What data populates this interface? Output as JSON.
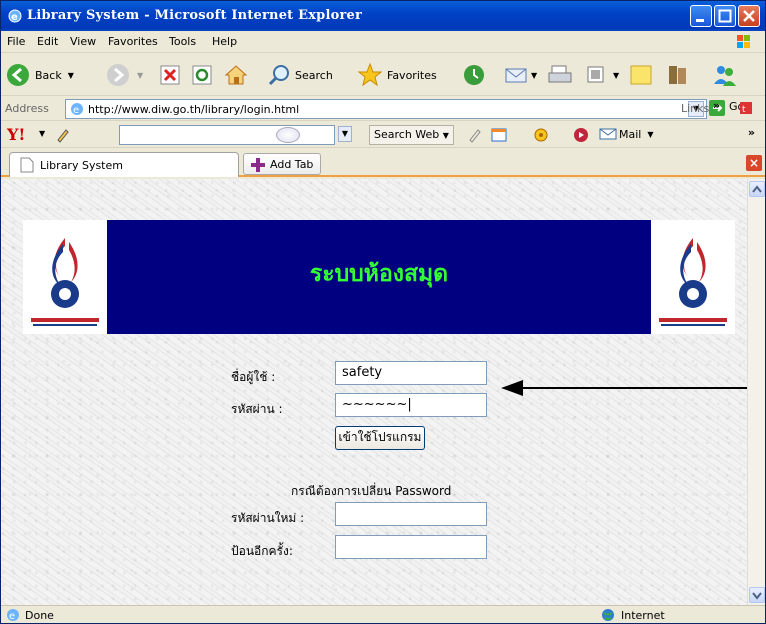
{
  "window": {
    "title": "Library System - Microsoft Internet Explorer"
  },
  "menu": [
    "File",
    "Edit",
    "View",
    "Favorites",
    "Tools",
    "Help"
  ],
  "toolbar": {
    "back_label": "Back",
    "search_label": "Search",
    "favorites_label": "Favorites"
  },
  "address": {
    "label": "Address",
    "url": "http://www.diw.go.th/library/login.html",
    "go_label": "Go",
    "links_label": "Links"
  },
  "yahoo": {
    "search_web_label": "Search Web",
    "mail_label": "Mail"
  },
  "tabs": {
    "active_label": "Library System",
    "add_tab_label": "Add Tab"
  },
  "page": {
    "heading": "ระบบห้องสมุด",
    "username_label": "ชื่อผู้ใช้ :",
    "username_value": "safety",
    "password_label": "รหัสผ่าน :",
    "password_value": "~~~~~~|",
    "login_button": "เข้าใช้โปรแกรม",
    "change_pw_text": "กรณีต้องการเปลี่ยน Password",
    "new_password_label": "รหัสผ่านใหม่ :",
    "confirm_label": "ป้อนอีกครั้ง:"
  },
  "status": {
    "left": "Done",
    "zone": "Internet"
  },
  "colors": {
    "banner_bg": "#000080",
    "heading_color": "#33ff33",
    "title_bar": "#0042c6"
  }
}
